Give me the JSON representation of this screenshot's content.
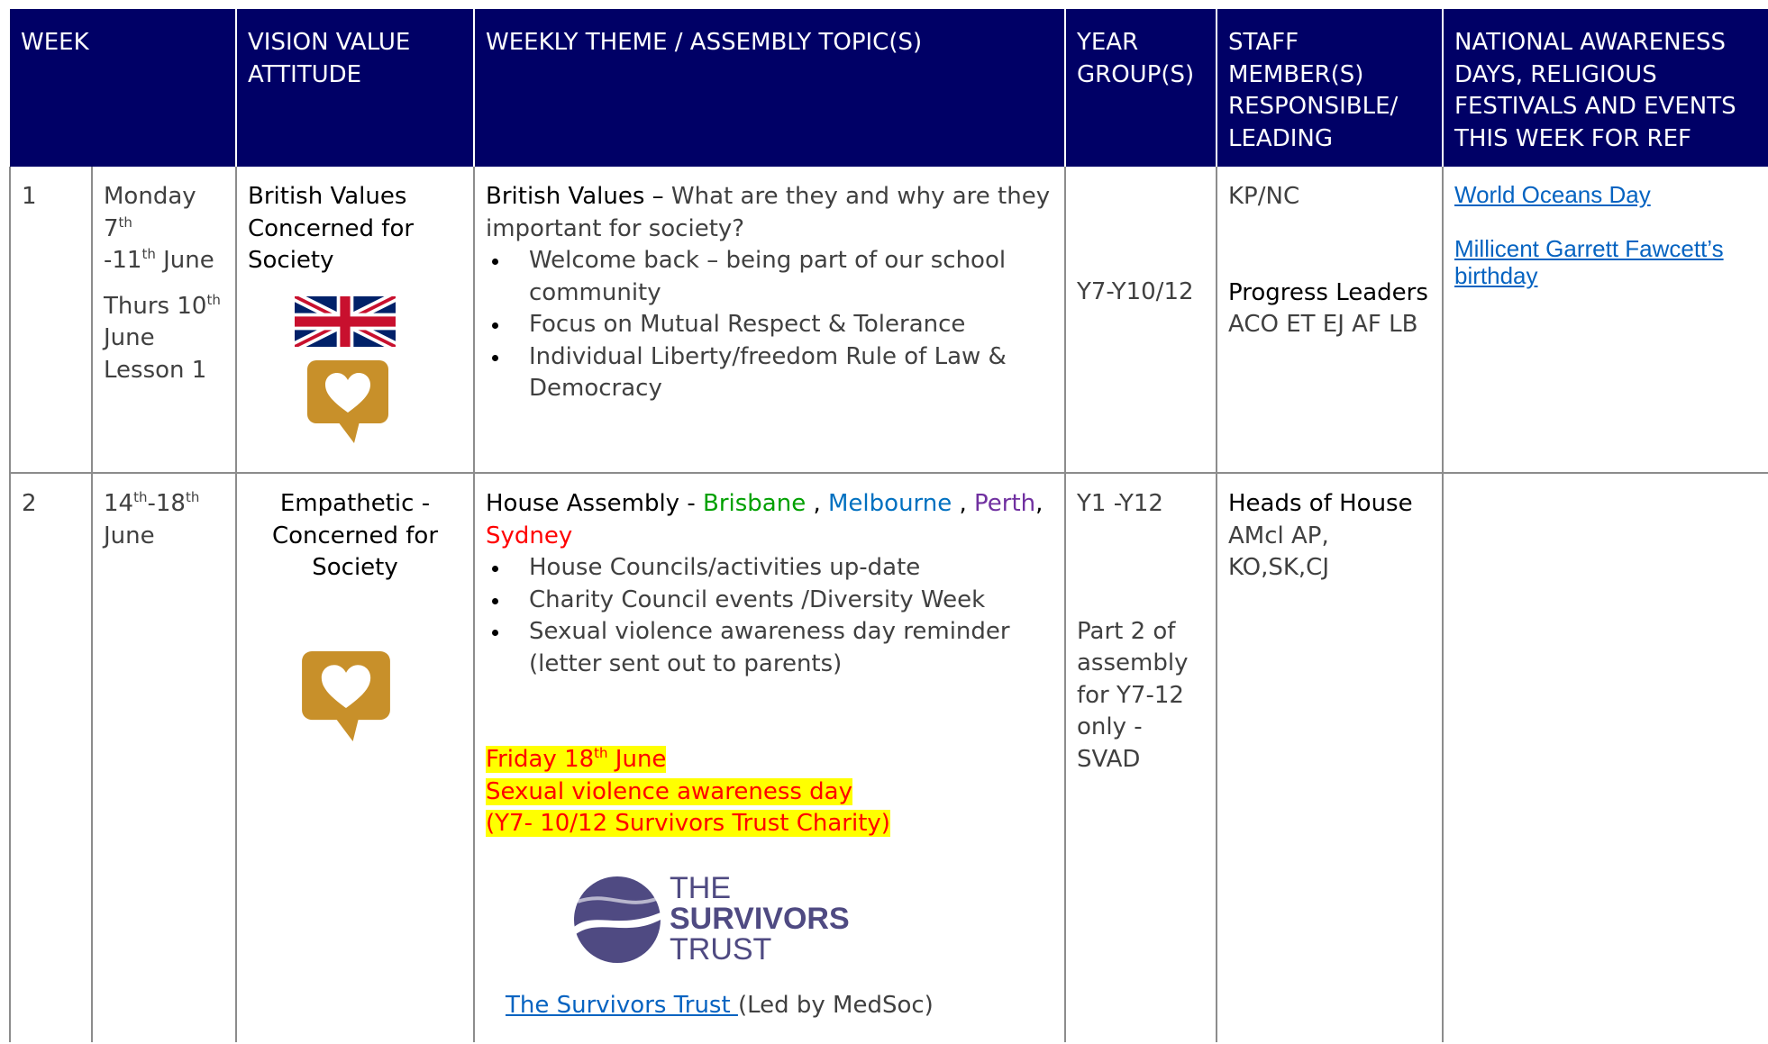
{
  "header": {
    "week": "WEEK",
    "vision": "VISION VALUE ATTITUDE",
    "theme": "WEEKLY THEME / ASSEMBLY TOPIC(S)",
    "year_group": "YEAR GROUP(S)",
    "staff": "STAFF MEMBER(S) RESPONSIBLE/ LEADING",
    "national": "NATIONAL AWARENESS DAYS, RELIGIOUS FESTIVALS AND EVENTS THIS WEEK FOR REF"
  },
  "rows": [
    {
      "week": "1",
      "date_a1": "Monday 7",
      "date_a1_sup": "th",
      "date_a2": "-11",
      "date_a2_sup": "th",
      "date_a3": " June",
      "date_b1": "Thurs 10",
      "date_b1_sup": "th",
      "date_b2": "June",
      "date_b3": "Lesson 1",
      "vision_lines": [
        "British Values",
        "Concerned for",
        "Society"
      ],
      "theme_title": "British Values –",
      "theme_intro": " What are they and why are they important for society?",
      "bullets": [
        "Welcome back – being part of our school community",
        "Focus on Mutual Respect & Tolerance",
        "Individual Liberty/freedom Rule of Law & Democracy"
      ],
      "year_group": "Y7-Y10/12",
      "staff_line1": "KP/NC",
      "staff_title": "Progress Leaders",
      "staff_names": "ACO  ET EJ AF LB",
      "national_links": [
        "World Oceans Day",
        "Millicent Garrett Fawcett’s birthday"
      ],
      "icons": [
        "union-jack-flag",
        "heart-speech-bubble-icon"
      ]
    },
    {
      "week": "2",
      "date_a1": "14",
      "date_a1_sup": "th",
      "date_a2": "-18",
      "date_a2_sup": "th",
      "date_a3": "June",
      "vision_lines": [
        "Empathetic -",
        "Concerned for",
        "Society"
      ],
      "theme_title": "House Assembly - ",
      "houses": [
        {
          "name": "Brisbane",
          "color": "#00a000"
        },
        {
          "name": "Melbourne",
          "color": "#0070c0"
        },
        {
          "name": "Perth",
          "color": "#7030a0"
        },
        {
          "name": "Sydney",
          "color": "#ff0000"
        }
      ],
      "sep_comma": " , ",
      "sep_comma2": ", ",
      "bullets": [
        "House Councils/activities up-date",
        "Charity Council events /Diversity Week",
        "Sexual violence awareness day reminder (letter sent out to parents)"
      ],
      "highlight_l1a": "Friday 18",
      "highlight_l1_sup": "th",
      "highlight_l1b": " June",
      "highlight_l2": "Sexual violence awareness day",
      "highlight_l3": "(Y7- 10/12 Survivors Trust  Charity)",
      "logo_text": [
        "THE",
        "SURVIVORS",
        "TRUST"
      ],
      "trust_link": "The Survivors Trust ",
      "trust_led": "(Led by MedSoc)",
      "year_group": "Y1 -Y12",
      "year_note": [
        "Part 2 of",
        "assembly",
        "for Y7-12",
        "only - SVAD"
      ],
      "staff_title": "Heads of House",
      "staff_names": "AMcl AP, KO,SK,CJ",
      "icons": [
        "heart-speech-bubble-icon",
        "survivors-trust-logo"
      ]
    }
  ],
  "colors": {
    "header_bg": "#000066",
    "heart_icon": "#c8902a",
    "link": "#0563c1",
    "highlight": "#ffff00",
    "highlight_text": "#ff0000",
    "logo_purple": "#4f4a82"
  }
}
